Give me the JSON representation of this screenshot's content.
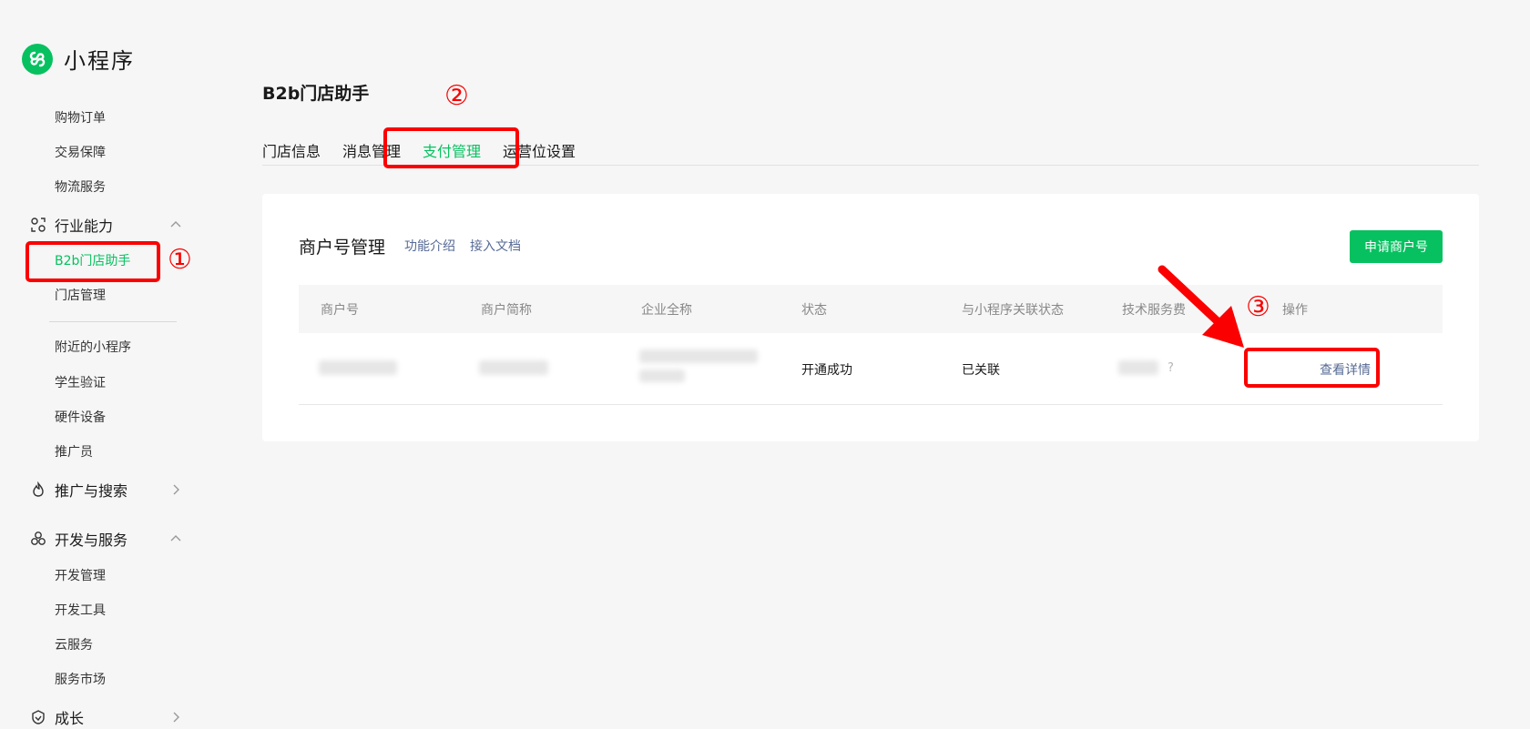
{
  "brand": {
    "name": "小程序",
    "logo": "mini-program-logo-icon",
    "color": "#07c160"
  },
  "sidebar": {
    "items_top": [
      "购物订单",
      "交易保障",
      "物流服务"
    ],
    "industry_group": {
      "label": "行业能力",
      "icon": "industry-icon",
      "expanded": true
    },
    "industry_items": [
      {
        "label": "B2b门店助手",
        "active": true
      },
      {
        "label": "门店管理"
      }
    ],
    "items_mid": [
      "附近的小程序",
      "学生验证",
      "硬件设备",
      "推广员"
    ],
    "promo_group": {
      "label": "推广与搜索",
      "icon": "promotion-icon",
      "expanded": false
    },
    "dev_group": {
      "label": "开发与服务",
      "icon": "dev-service-icon",
      "expanded": true
    },
    "dev_items": [
      "开发管理",
      "开发工具",
      "云服务",
      "服务市场"
    ],
    "growth_group": {
      "label": "成长",
      "icon": "growth-icon",
      "expanded": false
    }
  },
  "page": {
    "title": "B2b门店助手"
  },
  "tabs": [
    {
      "label": "门店信息"
    },
    {
      "label": "消息管理"
    },
    {
      "label": "支付管理",
      "active": true
    },
    {
      "label": "运营位设置"
    }
  ],
  "card": {
    "title": "商户号管理",
    "links": [
      "功能介绍",
      "接入文档"
    ],
    "apply_button": "申请商户号",
    "columns": [
      "商户号",
      "商户简称",
      "企业全称",
      "状态",
      "与小程序关联状态",
      "技术服务费",
      "操作"
    ],
    "rows": [
      {
        "merchant_id": "",
        "short_name": "",
        "full_name": "",
        "status": "开通成功",
        "link_status": "已关联",
        "fee": "",
        "fee_help": "?",
        "action": "查看详情"
      }
    ]
  },
  "annotations": {
    "step1": "①",
    "step2": "②",
    "step3": "③",
    "color": "#fa0000"
  },
  "colors": {
    "accent": "#07c160",
    "link": "#576b95",
    "annotation": "#fa0000"
  }
}
